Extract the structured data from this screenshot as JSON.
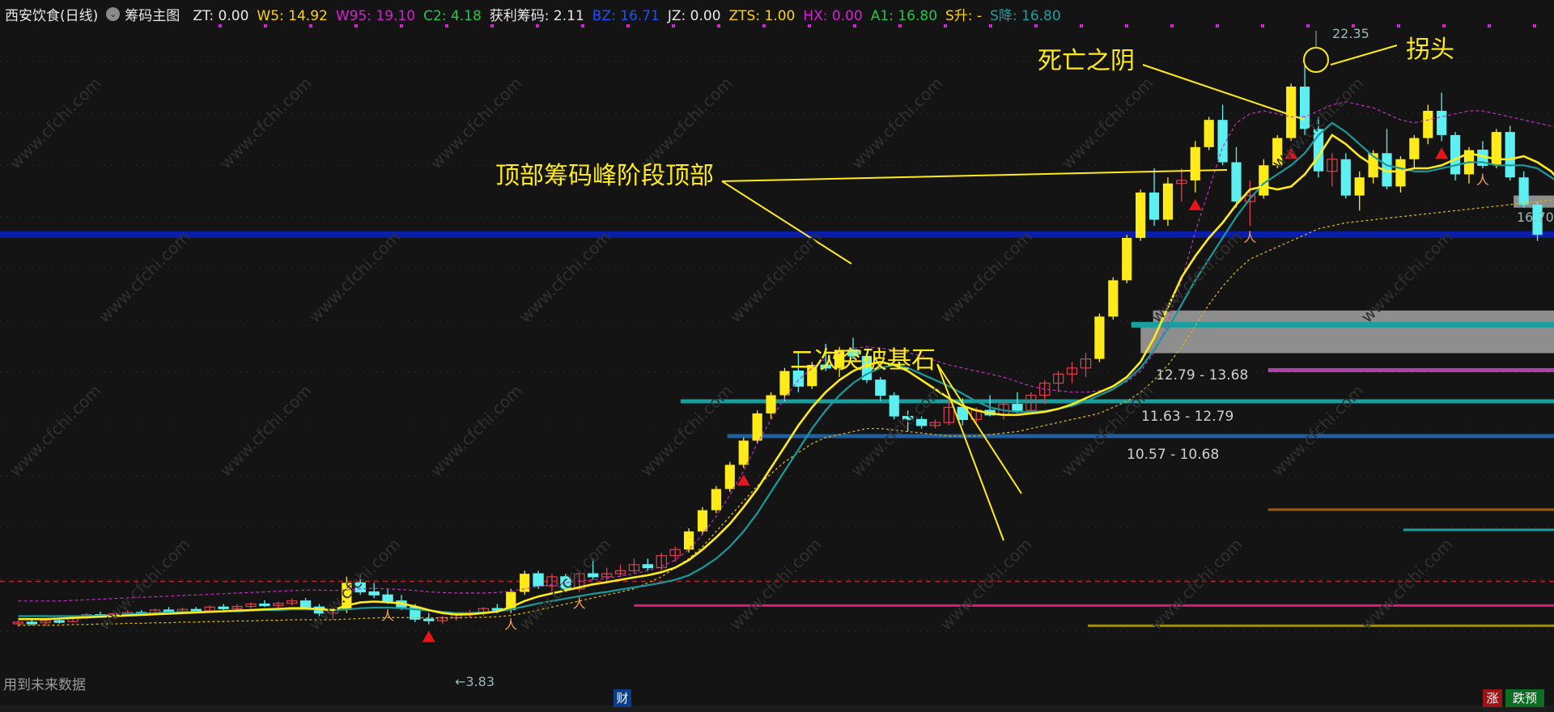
{
  "header": {
    "stock": "西安饮食(日线)",
    "indicator": "筹码主图",
    "items": [
      {
        "text": "ZT: 0.00",
        "color": "#e8e8e8"
      },
      {
        "text": "W5: 14.92",
        "color": "#ffd400"
      },
      {
        "text": "W95: 19.10",
        "color": "#d620d6"
      },
      {
        "text": "C2: 4.18",
        "color": "#22c74a"
      },
      {
        "text": "获利筹码: 2.11",
        "color": "#e8e8e8"
      },
      {
        "text": "BZ: 16.71",
        "color": "#1f4fff"
      },
      {
        "text": "JZ: 0.00",
        "color": "#e8e8e8"
      },
      {
        "text": "ZTS: 1.00",
        "color": "#ffd400"
      },
      {
        "text": "HX: 0.00",
        "color": "#d620d6"
      },
      {
        "text": "A1: 16.80",
        "color": "#22c74a"
      },
      {
        "text": "S升: -",
        "color": "#ffd400"
      },
      {
        "text": "S降: 16.80",
        "color": "#1aa0a0"
      }
    ]
  },
  "annotations": {
    "death_yin": "死亡之阴",
    "turn_head": "拐头",
    "top_chips": "顶部筹码峰阶段顶部",
    "second_break": "二次突破基石"
  },
  "price_tags": {
    "high": "22.35",
    "low": "3.83",
    "last": "16.70"
  },
  "chip_ranges": [
    "12.79 - 13.68",
    "11.63 - 12.79",
    "10.57 - 10.68"
  ],
  "footer": {
    "note": "用到未来数据",
    "cai": "财",
    "up": "涨",
    "down": "跌预"
  },
  "colors": {
    "background": "#141414",
    "bull": "#ffeb1a",
    "bear": "#5ef0f0",
    "small_bull": "#e0404e",
    "ma_fast": "#ffeb1a",
    "ma_mid": "#1a9a9a",
    "ma_dash": "#c030c0",
    "chip_peak": "#0a1ea8"
  },
  "chart_data": {
    "type": "candlestick",
    "y_range": [
      2.0,
      23.5
    ],
    "candles": [
      {
        "o": 3.85,
        "h": 3.95,
        "l": 3.75,
        "c": 3.9
      },
      {
        "o": 3.9,
        "h": 4.0,
        "l": 3.8,
        "c": 3.88
      },
      {
        "o": 3.88,
        "h": 3.98,
        "l": 3.78,
        "c": 3.95
      },
      {
        "o": 3.95,
        "h": 4.05,
        "l": 3.85,
        "c": 3.92
      },
      {
        "o": 3.92,
        "h": 4.1,
        "l": 3.9,
        "c": 4.05
      },
      {
        "o": 4.05,
        "h": 4.2,
        "l": 4.0,
        "c": 4.15
      },
      {
        "o": 4.15,
        "h": 4.25,
        "l": 4.05,
        "c": 4.1
      },
      {
        "o": 4.1,
        "h": 4.2,
        "l": 4.0,
        "c": 4.18
      },
      {
        "o": 4.18,
        "h": 4.3,
        "l": 4.1,
        "c": 4.22
      },
      {
        "o": 4.22,
        "h": 4.3,
        "l": 4.12,
        "c": 4.2
      },
      {
        "o": 4.2,
        "h": 4.35,
        "l": 4.15,
        "c": 4.3
      },
      {
        "o": 4.3,
        "h": 4.4,
        "l": 4.2,
        "c": 4.25
      },
      {
        "o": 4.25,
        "h": 4.38,
        "l": 4.18,
        "c": 4.32
      },
      {
        "o": 4.32,
        "h": 4.4,
        "l": 4.25,
        "c": 4.28
      },
      {
        "o": 4.28,
        "h": 4.45,
        "l": 4.22,
        "c": 4.4
      },
      {
        "o": 4.4,
        "h": 4.5,
        "l": 4.3,
        "c": 4.35
      },
      {
        "o": 4.35,
        "h": 4.5,
        "l": 4.28,
        "c": 4.42
      },
      {
        "o": 4.42,
        "h": 4.55,
        "l": 4.35,
        "c": 4.5
      },
      {
        "o": 4.5,
        "h": 4.62,
        "l": 4.4,
        "c": 4.45
      },
      {
        "o": 4.45,
        "h": 4.58,
        "l": 4.38,
        "c": 4.52
      },
      {
        "o": 4.52,
        "h": 4.68,
        "l": 4.45,
        "c": 4.6
      },
      {
        "o": 4.6,
        "h": 4.7,
        "l": 4.35,
        "c": 4.4
      },
      {
        "o": 4.4,
        "h": 4.5,
        "l": 4.1,
        "c": 4.2
      },
      {
        "o": 4.2,
        "h": 4.35,
        "l": 4.0,
        "c": 4.3
      },
      {
        "o": 4.3,
        "h": 5.4,
        "l": 4.2,
        "c": 5.2
      },
      {
        "o": 5.2,
        "h": 5.5,
        "l": 4.8,
        "c": 4.9
      },
      {
        "o": 4.9,
        "h": 5.2,
        "l": 4.7,
        "c": 4.8
      },
      {
        "o": 4.8,
        "h": 5.0,
        "l": 4.5,
        "c": 4.6
      },
      {
        "o": 4.6,
        "h": 4.8,
        "l": 4.3,
        "c": 4.4
      },
      {
        "o": 4.4,
        "h": 4.5,
        "l": 3.9,
        "c": 4.0
      },
      {
        "o": 4.0,
        "h": 4.2,
        "l": 3.83,
        "c": 3.95
      },
      {
        "o": 3.95,
        "h": 4.1,
        "l": 3.85,
        "c": 4.05
      },
      {
        "o": 4.05,
        "h": 4.2,
        "l": 3.95,
        "c": 4.15
      },
      {
        "o": 4.15,
        "h": 4.3,
        "l": 4.05,
        "c": 4.2
      },
      {
        "o": 4.2,
        "h": 4.4,
        "l": 4.1,
        "c": 4.35
      },
      {
        "o": 4.35,
        "h": 4.5,
        "l": 4.2,
        "c": 4.3
      },
      {
        "o": 4.3,
        "h": 5.0,
        "l": 4.2,
        "c": 4.9
      },
      {
        "o": 4.9,
        "h": 5.6,
        "l": 4.8,
        "c": 5.5
      },
      {
        "o": 5.5,
        "h": 5.6,
        "l": 5.0,
        "c": 5.1
      },
      {
        "o": 5.1,
        "h": 5.5,
        "l": 4.9,
        "c": 5.4
      },
      {
        "o": 5.4,
        "h": 5.5,
        "l": 4.9,
        "c": 5.0
      },
      {
        "o": 5.0,
        "h": 5.6,
        "l": 4.9,
        "c": 5.5
      },
      {
        "o": 5.5,
        "h": 6.0,
        "l": 5.3,
        "c": 5.4
      },
      {
        "o": 5.4,
        "h": 5.7,
        "l": 5.2,
        "c": 5.5
      },
      {
        "o": 5.5,
        "h": 5.8,
        "l": 5.4,
        "c": 5.6
      },
      {
        "o": 5.6,
        "h": 6.0,
        "l": 5.5,
        "c": 5.8
      },
      {
        "o": 5.8,
        "h": 6.0,
        "l": 5.6,
        "c": 5.7
      },
      {
        "o": 5.7,
        "h": 6.2,
        "l": 5.6,
        "c": 6.1
      },
      {
        "o": 6.1,
        "h": 6.4,
        "l": 5.9,
        "c": 6.3
      },
      {
        "o": 6.3,
        "h": 7.0,
        "l": 6.2,
        "c": 6.9
      },
      {
        "o": 6.9,
        "h": 7.7,
        "l": 6.8,
        "c": 7.6
      },
      {
        "o": 7.6,
        "h": 8.4,
        "l": 7.5,
        "c": 8.3
      },
      {
        "o": 8.3,
        "h": 9.2,
        "l": 8.2,
        "c": 9.1
      },
      {
        "o": 9.1,
        "h": 10.0,
        "l": 9.0,
        "c": 9.9
      },
      {
        "o": 9.9,
        "h": 10.9,
        "l": 9.8,
        "c": 10.8
      },
      {
        "o": 10.8,
        "h": 11.5,
        "l": 10.6,
        "c": 11.4
      },
      {
        "o": 11.4,
        "h": 12.3,
        "l": 11.2,
        "c": 12.2
      },
      {
        "o": 12.2,
        "h": 12.8,
        "l": 11.5,
        "c": 11.7
      },
      {
        "o": 11.7,
        "h": 12.5,
        "l": 11.6,
        "c": 12.4
      },
      {
        "o": 12.4,
        "h": 13.1,
        "l": 12.2,
        "c": 12.3
      },
      {
        "o": 12.3,
        "h": 13.0,
        "l": 12.0,
        "c": 12.9
      },
      {
        "o": 12.9,
        "h": 13.3,
        "l": 12.6,
        "c": 12.7
      },
      {
        "o": 12.7,
        "h": 12.8,
        "l": 11.8,
        "c": 11.9
      },
      {
        "o": 11.9,
        "h": 12.0,
        "l": 11.2,
        "c": 11.4
      },
      {
        "o": 11.4,
        "h": 11.5,
        "l": 10.6,
        "c": 10.7
      },
      {
        "o": 10.7,
        "h": 10.9,
        "l": 10.2,
        "c": 10.6
      },
      {
        "o": 10.6,
        "h": 10.7,
        "l": 10.3,
        "c": 10.4
      },
      {
        "o": 10.4,
        "h": 10.6,
        "l": 10.3,
        "c": 10.5
      },
      {
        "o": 10.5,
        "h": 11.2,
        "l": 10.4,
        "c": 11.0
      },
      {
        "o": 11.0,
        "h": 11.3,
        "l": 10.4,
        "c": 10.6
      },
      {
        "o": 10.6,
        "h": 11.0,
        "l": 10.5,
        "c": 10.9
      },
      {
        "o": 10.9,
        "h": 11.4,
        "l": 10.7,
        "c": 10.75
      },
      {
        "o": 10.75,
        "h": 11.2,
        "l": 10.6,
        "c": 11.1
      },
      {
        "o": 11.1,
        "h": 11.5,
        "l": 10.8,
        "c": 10.9
      },
      {
        "o": 10.9,
        "h": 11.5,
        "l": 10.8,
        "c": 11.4
      },
      {
        "o": 11.4,
        "h": 11.9,
        "l": 11.1,
        "c": 11.8
      },
      {
        "o": 11.8,
        "h": 12.2,
        "l": 11.5,
        "c": 12.1
      },
      {
        "o": 12.1,
        "h": 12.5,
        "l": 11.8,
        "c": 12.3
      },
      {
        "o": 12.3,
        "h": 12.8,
        "l": 12.0,
        "c": 12.6
      },
      {
        "o": 12.6,
        "h": 14.1,
        "l": 12.5,
        "c": 14.0
      },
      {
        "o": 14.0,
        "h": 15.3,
        "l": 13.9,
        "c": 15.2
      },
      {
        "o": 15.2,
        "h": 16.7,
        "l": 15.1,
        "c": 16.6
      },
      {
        "o": 16.6,
        "h": 18.2,
        "l": 16.5,
        "c": 18.1
      },
      {
        "o": 18.1,
        "h": 18.9,
        "l": 17.0,
        "c": 17.2
      },
      {
        "o": 17.2,
        "h": 18.6,
        "l": 17.0,
        "c": 18.4
      },
      {
        "o": 18.4,
        "h": 18.9,
        "l": 17.8,
        "c": 18.5
      },
      {
        "o": 18.5,
        "h": 19.8,
        "l": 18.1,
        "c": 19.6
      },
      {
        "o": 19.6,
        "h": 20.6,
        "l": 19.5,
        "c": 20.5
      },
      {
        "o": 20.5,
        "h": 21.0,
        "l": 19.0,
        "c": 19.1
      },
      {
        "o": 19.1,
        "h": 19.6,
        "l": 17.6,
        "c": 17.8
      },
      {
        "o": 17.8,
        "h": 18.5,
        "l": 17.0,
        "c": 18.0
      },
      {
        "o": 18.0,
        "h": 19.2,
        "l": 17.9,
        "c": 19.0
      },
      {
        "o": 19.0,
        "h": 20.0,
        "l": 18.9,
        "c": 19.9
      },
      {
        "o": 19.9,
        "h": 21.7,
        "l": 19.8,
        "c": 21.6
      },
      {
        "o": 21.6,
        "h": 22.35,
        "l": 20.0,
        "c": 20.2
      },
      {
        "o": 20.2,
        "h": 20.6,
        "l": 18.6,
        "c": 18.8
      },
      {
        "o": 18.8,
        "h": 19.4,
        "l": 18.3,
        "c": 19.2
      },
      {
        "o": 19.2,
        "h": 19.4,
        "l": 17.9,
        "c": 18.0
      },
      {
        "o": 18.0,
        "h": 18.8,
        "l": 17.5,
        "c": 18.6
      },
      {
        "o": 18.6,
        "h": 19.5,
        "l": 18.4,
        "c": 19.4
      },
      {
        "o": 19.4,
        "h": 20.2,
        "l": 18.2,
        "c": 18.3
      },
      {
        "o": 18.3,
        "h": 19.3,
        "l": 18.1,
        "c": 19.2
      },
      {
        "o": 19.2,
        "h": 20.0,
        "l": 18.9,
        "c": 19.9
      },
      {
        "o": 19.9,
        "h": 21.0,
        "l": 19.7,
        "c": 20.8
      },
      {
        "o": 20.8,
        "h": 21.4,
        "l": 19.8,
        "c": 20.0
      },
      {
        "o": 20.0,
        "h": 20.1,
        "l": 18.5,
        "c": 18.7
      },
      {
        "o": 18.7,
        "h": 19.6,
        "l": 18.4,
        "c": 19.5
      },
      {
        "o": 19.5,
        "h": 19.8,
        "l": 18.9,
        "c": 19.0
      },
      {
        "o": 19.0,
        "h": 20.2,
        "l": 18.9,
        "c": 20.1
      },
      {
        "o": 20.1,
        "h": 20.3,
        "l": 18.5,
        "c": 18.6
      },
      {
        "o": 18.6,
        "h": 18.8,
        "l": 17.6,
        "c": 17.7
      },
      {
        "o": 17.7,
        "h": 17.8,
        "l": 16.5,
        "c": 16.7
      }
    ],
    "ma_fast": [
      4.0,
      4.0,
      4.0,
      4.02,
      4.04,
      4.06,
      4.08,
      4.1,
      4.12,
      4.14,
      4.16,
      4.18,
      4.2,
      4.22,
      4.24,
      4.26,
      4.28,
      4.3,
      4.32,
      4.34,
      4.36,
      4.36,
      4.33,
      4.3,
      4.45,
      4.55,
      4.58,
      4.56,
      4.52,
      4.42,
      4.3,
      4.2,
      4.15,
      4.16,
      4.2,
      4.25,
      4.4,
      4.6,
      4.75,
      4.85,
      4.95,
      5.05,
      5.15,
      5.22,
      5.3,
      5.38,
      5.45,
      5.55,
      5.7,
      5.95,
      6.3,
      6.7,
      7.15,
      7.7,
      8.3,
      9.0,
      9.7,
      10.4,
      11.0,
      11.5,
      11.9,
      12.2,
      12.4,
      12.5,
      12.4,
      12.2,
      11.9,
      11.6,
      11.3,
      11.05,
      10.9,
      10.8,
      10.75,
      10.75,
      10.8,
      10.85,
      10.95,
      11.1,
      11.3,
      11.5,
      11.7,
      12.0,
      12.5,
      13.3,
      14.3,
      15.3,
      16.0,
      16.6,
      17.1,
      17.7,
      18.2,
      18.3,
      18.2,
      18.3,
      18.7,
      19.3,
      20.0,
      19.7,
      19.3,
      19.0,
      18.8,
      18.8,
      18.9,
      18.9,
      19.0,
      19.2,
      19.4,
      19.3,
      19.2,
      19.2,
      19.3,
      19.1,
      18.8,
      18.3
    ],
    "ma_mid": [
      4.1,
      4.1,
      4.1,
      4.1,
      4.1,
      4.1,
      4.12,
      4.14,
      4.16,
      4.18,
      4.2,
      4.22,
      4.22,
      4.24,
      4.24,
      4.26,
      4.26,
      4.28,
      4.3,
      4.3,
      4.32,
      4.32,
      4.32,
      4.3,
      4.32,
      4.36,
      4.38,
      4.38,
      4.36,
      4.32,
      4.28,
      4.24,
      4.2,
      4.2,
      4.22,
      4.25,
      4.32,
      4.42,
      4.52,
      4.6,
      4.68,
      4.76,
      4.84,
      4.9,
      4.98,
      5.05,
      5.12,
      5.2,
      5.3,
      5.45,
      5.7,
      6.0,
      6.4,
      6.9,
      7.5,
      8.2,
      8.9,
      9.6,
      10.3,
      10.9,
      11.4,
      11.8,
      12.1,
      12.3,
      12.4,
      12.3,
      12.1,
      11.9,
      11.7,
      11.45,
      11.2,
      11.0,
      10.9,
      10.85,
      10.85,
      10.88,
      10.95,
      11.05,
      11.2,
      11.4,
      11.6,
      11.9,
      12.3,
      12.9,
      13.6,
      14.4,
      15.2,
      15.9,
      16.6,
      17.3,
      17.9,
      18.4,
      18.7,
      19.0,
      19.4,
      20.0,
      20.4,
      20.1,
      19.7,
      19.3,
      19.0,
      18.9,
      18.8,
      18.8,
      18.9,
      19.0,
      19.1,
      19.1,
      19.0,
      19.0,
      19.0,
      18.9,
      18.6,
      18.3
    ],
    "ma_dash": [
      4.6,
      4.6,
      4.6,
      4.6,
      4.62,
      4.64,
      4.66,
      4.68,
      4.7,
      4.72,
      4.74,
      4.76,
      4.78,
      4.8,
      4.82,
      4.84,
      4.86,
      4.88,
      4.9,
      4.92,
      4.94,
      4.96,
      4.96,
      4.95,
      4.96,
      5.0,
      5.02,
      5.0,
      4.98,
      4.95,
      4.9,
      4.88,
      4.86,
      4.86,
      4.86,
      4.88,
      4.92,
      5.0,
      5.08,
      5.14,
      5.2,
      5.26,
      5.3,
      5.35,
      5.42,
      5.5,
      5.6,
      5.75,
      5.95,
      6.3,
      6.8,
      7.4,
      8.1,
      8.9,
      9.8,
      10.6,
      11.3,
      11.9,
      12.3,
      12.6,
      12.8,
      12.95,
      13.0,
      12.95,
      12.9,
      12.8,
      12.7,
      12.55,
      12.4,
      12.3,
      12.2,
      12.1,
      12.0,
      11.85,
      11.7,
      11.6,
      11.55,
      11.5,
      11.5,
      11.55,
      11.65,
      11.85,
      12.2,
      12.8,
      13.8,
      15.2,
      16.8,
      18.2,
      19.6,
      20.4,
      20.7,
      20.8,
      20.7,
      20.6,
      20.6,
      20.8,
      21.0,
      21.1,
      21.0,
      20.9,
      20.7,
      20.5,
      20.4,
      20.5,
      20.6,
      20.7,
      20.8,
      20.8,
      20.7,
      20.6,
      20.5,
      20.4,
      20.3,
      20.2
    ],
    "ma_long": [
      3.8,
      3.8,
      3.8,
      3.8,
      3.82,
      3.82,
      3.84,
      3.84,
      3.86,
      3.86,
      3.88,
      3.88,
      3.9,
      3.9,
      3.92,
      3.92,
      3.94,
      3.94,
      3.96,
      3.96,
      3.98,
      3.98,
      3.98,
      3.98,
      4.0,
      4.02,
      4.04,
      4.05,
      4.05,
      4.05,
      4.04,
      4.04,
      4.04,
      4.05,
      4.06,
      4.08,
      4.12,
      4.2,
      4.3,
      4.4,
      4.5,
      4.6,
      4.7,
      4.8,
      4.9,
      5.0,
      5.2,
      5.4,
      5.7,
      6.0,
      6.4,
      6.9,
      7.4,
      7.9,
      8.4,
      8.8,
      9.2,
      9.5,
      9.8,
      10.0,
      10.1,
      10.2,
      10.3,
      10.3,
      10.25,
      10.2,
      10.15,
      10.1,
      10.05,
      10.05,
      10.05,
      10.1,
      10.15,
      10.2,
      10.3,
      10.4,
      10.5,
      10.6,
      10.7,
      10.8,
      11.0,
      11.2,
      11.5,
      11.9,
      12.4,
      13.0,
      13.7,
      14.4,
      15.0,
      15.5,
      15.9,
      16.1,
      16.3,
      16.5,
      16.7,
      16.9,
      17.0,
      17.1,
      17.15,
      17.2,
      17.25,
      17.3,
      17.35,
      17.4,
      17.45,
      17.5,
      17.55,
      17.6,
      17.65,
      17.7,
      17.75,
      17.8,
      17.85,
      17.9
    ],
    "chip_levels": [
      {
        "price": 16.71,
        "color": "#0a1ea8",
        "width": 8,
        "from": 0.0
      },
      {
        "price": 13.73,
        "color": "#1a9ea0",
        "width": 7,
        "from": 0.728
      },
      {
        "price": 11.2,
        "color": "#1a9ea0",
        "width": 5,
        "from": 0.438
      },
      {
        "price": 10.05,
        "color": "#215fa0",
        "width": 5,
        "from": 0.468
      },
      {
        "price": 12.23,
        "color": "#b040b0",
        "width": 5,
        "from": 0.816
      },
      {
        "price": 7.62,
        "color": "#9a5a10",
        "width": 3,
        "from": 0.816
      },
      {
        "price": 6.95,
        "color": "#1a9ea0",
        "width": 3,
        "from": 0.903
      },
      {
        "price": 4.45,
        "color": "#e01a7a",
        "width": 3,
        "from": 0.408
      },
      {
        "price": 3.78,
        "color": "#9c8e10",
        "width": 3,
        "from": 0.7
      }
    ],
    "gray_zones": [
      {
        "from": 13.68,
        "to": 14.2,
        "x0": 0.742
      },
      {
        "from": 12.79,
        "to": 13.68,
        "x0": 0.734
      },
      {
        "from": 18.0,
        "to": 17.6,
        "x0": 0.974
      }
    ],
    "red_dash_level": 5.25
  }
}
